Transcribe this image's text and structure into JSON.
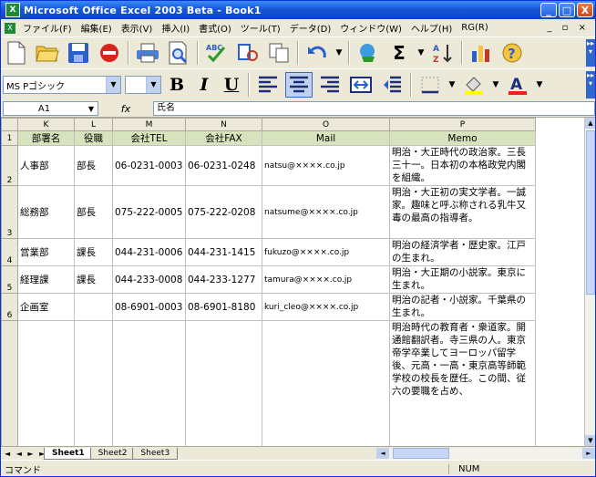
{
  "window": {
    "title": "Microsoft Office Excel 2003 Beta - Book1",
    "controls": {
      "minimize": "_",
      "maximize": "□",
      "close": "X"
    }
  },
  "menu": {
    "items": [
      "ファイル(F)",
      "編集(E)",
      "表示(V)",
      "挿入(I)",
      "書式(O)",
      "ツール(T)",
      "データ(D)",
      "ウィンドウ(W)",
      "ヘルプ(H)",
      "RG(R)"
    ],
    "window_controls": "_ ▫ ×"
  },
  "font_toolbar": {
    "font_name": "MS Pゴシック",
    "font_size": "",
    "bold": "B",
    "italic": "I",
    "underline": "U"
  },
  "formula_bar": {
    "name_box": "A1",
    "fx": "fx",
    "content": "氏名"
  },
  "sheet": {
    "col_headers": [
      "K",
      "L",
      "M",
      "N",
      "O",
      "P"
    ],
    "row_headers": [
      "1",
      "2",
      "3",
      "4",
      "5",
      "6"
    ],
    "header_row": [
      "部署名",
      "役職",
      "会社TEL",
      "会社FAX",
      "Mail",
      "Memo"
    ],
    "rows": [
      [
        "人事部",
        "部長",
        "06-0231-0003",
        "06-0231-0248",
        "natsu@××××.co.jp",
        "明治・大正時代の政治家。三長三十一。日本初の本格政党内閣を組織。"
      ],
      [
        "総務部",
        "部長",
        "075-222-0005",
        "075-222-0208",
        "natsume@××××.co.jp",
        "明治・大正初の実文学者。一誠家。趣味と呼ぶ称される乳牛又毒の最高の指導者。"
      ],
      [
        "営業部",
        "課長",
        "044-231-0006",
        "044-231-1415",
        "fukuzo@××××.co.jp",
        "明治の経済学者・歴史家。江戸の生まれ。"
      ],
      [
        "経理課",
        "課長",
        "044-233-0008",
        "044-233-1277",
        "tamura@××××.co.jp",
        "明治・大正期の小説家。東京に生まれ。"
      ],
      [
        "企画室",
        "",
        "08-6901-0003",
        "08-6901-8180",
        "kuri_cleo@××××.co.jp",
        "明治の記者・小説家。千葉県の生まれ。"
      ]
    ],
    "extra_memo": "明治時代の教育者・衆道家。開通館翻訳者。寺三県の人。東京帝学卒業してヨーロッパ留学後、元高・一高・東京高等師範学校の校長を歴任。この間、従六の要職を占め、"
  },
  "tabs": {
    "nav": "◄ ◄ ► ►",
    "sheets": [
      "Sheet1",
      "Sheet2",
      "Sheet3"
    ],
    "active_index": 0
  },
  "status": {
    "left": "コマンド",
    "right": "NUM"
  }
}
